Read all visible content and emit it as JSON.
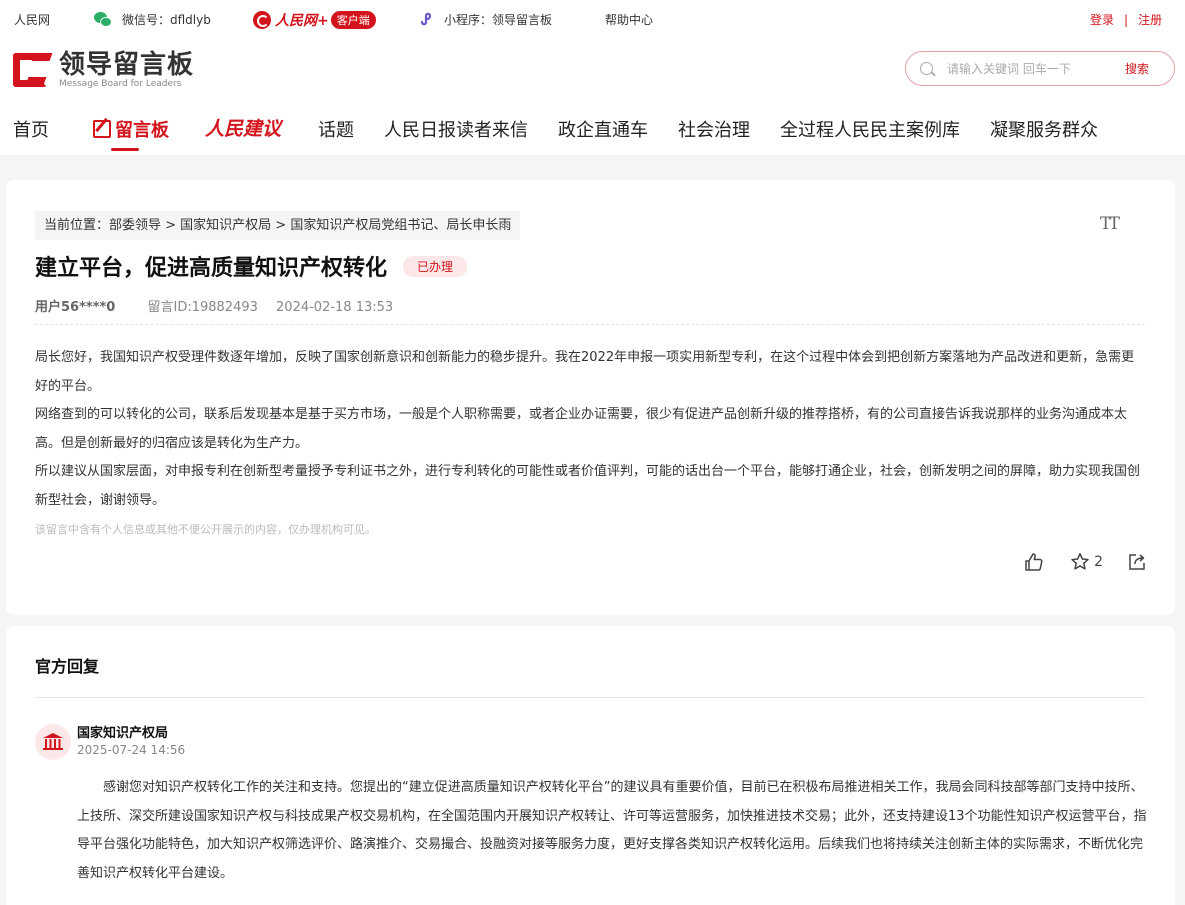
{
  "topbar": {
    "site": "人民网",
    "wechat": "微信号：dfldlyb",
    "app_name": "人民网+",
    "app_tag": "客户端",
    "miniprogram": "小程序：领导留言板",
    "help": "帮助中心",
    "login": "登录",
    "separator": "|",
    "register": "注册"
  },
  "header": {
    "logo_cn": "领导留言板",
    "logo_en": "Message Board for Leaders",
    "search_placeholder": "请输入关键词 回车一下",
    "search_button": "搜索"
  },
  "nav": {
    "items": [
      "首页",
      "留言板",
      "人民建议",
      "话题",
      "人民日报读者来信",
      "政企直通车",
      "社会治理",
      "全过程人民民主案例库",
      "凝聚服务群众"
    ],
    "active_index": 1
  },
  "message": {
    "breadcrumb": "当前位置：部委领导 > 国家知识产权局 > 国家知识产权局党组书记、局长申长雨",
    "font_toggle": "TT",
    "title": "建立平台，促进高质量知识产权转化",
    "status": "已办理",
    "user": "用户56****0",
    "message_id": "留言ID:19882493",
    "time": "2024-02-18 13:53",
    "paragraphs": [
      "局长您好，我国知识产权受理件数逐年增加，反映了国家创新意识和创新能力的稳步提升。我在2022年申报一项实用新型专利，在这个过程中体会到把创新方案落地为产品改进和更新，急需更好的平台。",
      "网络查到的可以转化的公司，联系后发现基本是基于买方市场，一般是个人职称需要，或者企业办证需要，很少有促进产品创新升级的推荐搭桥，有的公司直接告诉我说那样的业务沟通成本太高。但是创新最好的归宿应该是转化为生产力。",
      "所以建议从国家层面，对申报专利在创新型考量授予专利证书之外，进行专利转化的可能性或者价值评判，可能的话出台一个平台，能够打通企业，社会，创新发明之间的屏障，助力实现我国创新型社会，谢谢领导。"
    ],
    "privacy_note": "该留言中含有个人信息或其他不便公开展示的内容，仅办理机构可见。",
    "favorite_count": "2"
  },
  "reply": {
    "section_title": "官方回复",
    "org": "国家知识产权局",
    "time": "2025-07-24 14:56",
    "text": "感谢您对知识产权转化工作的关注和支持。您提出的“建立促进高质量知识产权转化平台”的建议具有重要价值，目前已在积极布局推进相关工作，我局会同科技部等部门支持中技所、上技所、深交所建设国家知识产权与科技成果产权交易机构，在全国范围内开展知识产权转让、许可等运营服务，加快推进技术交易；此外，还支持建设13个功能性知识产权运营平台，指导平台强化功能特色，加大知识产权筛选评价、路演推介、交易撮合、投融资对接等服务力度，更好支撑各类知识产权转化运用。后续我们也将持续关注创新主体的实际需求，不断优化完善知识产权转化平台建设。"
  },
  "icons": {
    "wechat": "wechat-icon",
    "miniprogram": "miniprogram-icon",
    "search": "search-icon",
    "edit": "edit-icon",
    "like": "thumbs-up-icon",
    "favorite": "star-icon",
    "share": "share-icon",
    "org": "bank-icon"
  },
  "colors": {
    "accent": "#d4141c",
    "badge_bg": "#fce8e9",
    "page_bg": "#f5f5f7"
  }
}
